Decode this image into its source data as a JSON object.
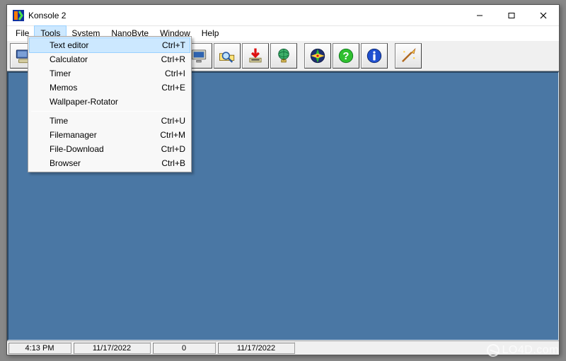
{
  "window": {
    "title": "Konsole 2"
  },
  "menubar": [
    "File",
    "Tools",
    "System",
    "NanoByte",
    "Window",
    "Help"
  ],
  "active_menu_index": 1,
  "dropdown": {
    "items": [
      {
        "label": "Text editor",
        "shortcut": "Ctrl+T",
        "hover": true
      },
      {
        "label": "Calculator",
        "shortcut": "Ctrl+R"
      },
      {
        "label": "Timer",
        "shortcut": "Ctrl+I"
      },
      {
        "label": "Memos",
        "shortcut": "Ctrl+E"
      },
      {
        "label": "Wallpaper-Rotator",
        "shortcut": ""
      },
      {
        "separator": true
      },
      {
        "label": "Time",
        "shortcut": "Ctrl+U"
      },
      {
        "label": "Filemanager",
        "shortcut": "Ctrl+M"
      },
      {
        "label": "File-Download",
        "shortcut": "Ctrl+D"
      },
      {
        "label": "Browser",
        "shortcut": "Ctrl+B"
      }
    ]
  },
  "toolbar": {
    "icons": [
      "computer-icon",
      "folder-open-icon",
      "notepad-icon",
      "calculator-icon",
      "timer-icon",
      "notes-icon",
      "monitor-icon",
      "search-icon",
      "download-icon",
      "globe-icon",
      "compass-icon",
      "help-icon",
      "info-icon",
      "wand-icon"
    ],
    "separators_after": [
      0,
      9,
      12
    ]
  },
  "status": {
    "time": "4:13 PM",
    "date1": "11/17/2022",
    "count": "0",
    "date2": "11/17/2022"
  },
  "colors": {
    "client_bg": "#4a77a4",
    "highlight": "#cce8ff"
  },
  "watermark": "LO4D.com"
}
